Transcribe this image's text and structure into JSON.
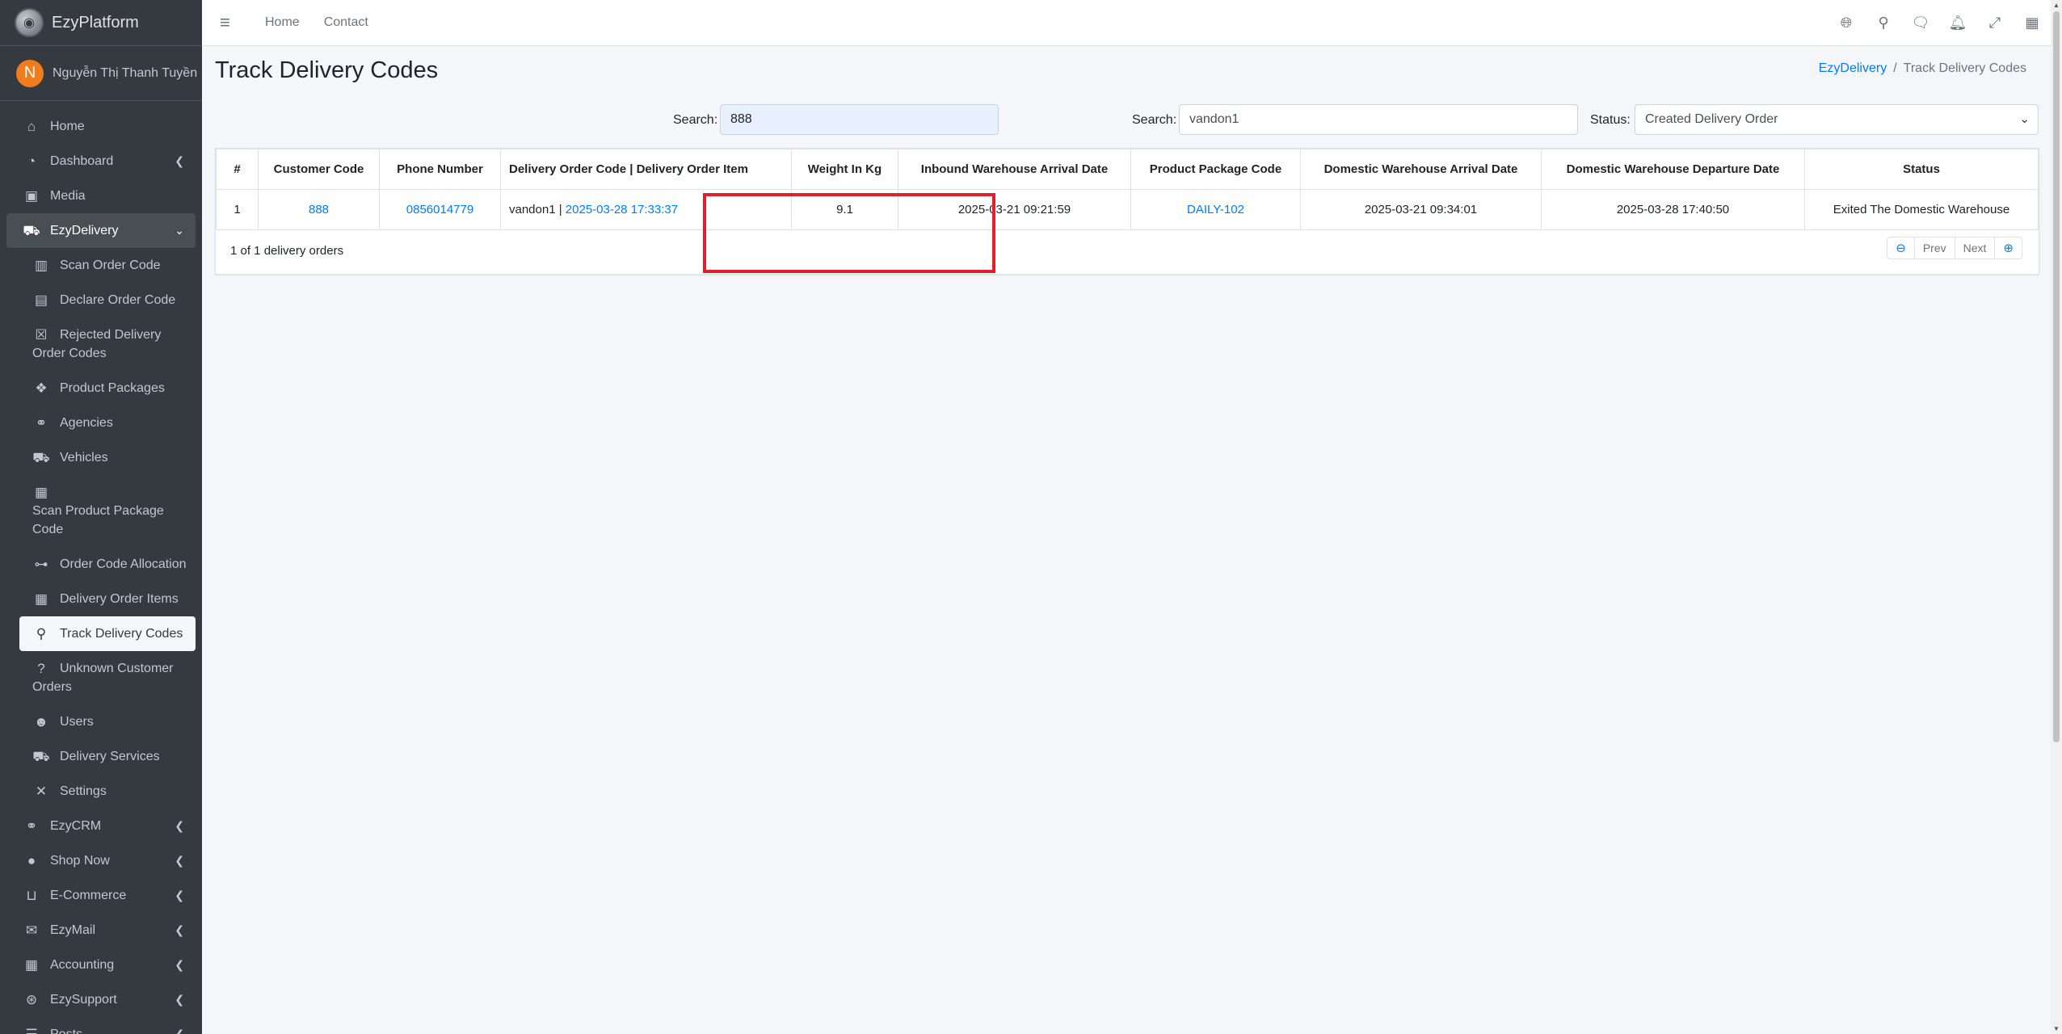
{
  "brand": {
    "name": "EzyPlatform",
    "logo_icon": "ezyplatform-logo-icon"
  },
  "user": {
    "initial": "N",
    "name": "Nguyễn Thị Thanh Tuyền"
  },
  "sidebar": {
    "items": [
      {
        "label": "Home",
        "icon": "home-icon"
      },
      {
        "label": "Dashboard",
        "icon": "dashboard-icon"
      },
      {
        "label": "Media",
        "icon": "image-icon"
      },
      {
        "label": "EzyDelivery",
        "icon": "truck-icon"
      }
    ],
    "sub_items": [
      {
        "label": "Scan Order Code",
        "icon": "barcode-icon"
      },
      {
        "label": "Declare Order Code",
        "icon": "file-icon"
      },
      {
        "label": "Rejected Delivery",
        "label2": "Order Codes",
        "icon": "x-box-icon"
      },
      {
        "label": "Product Packages",
        "icon": "boxes-icon"
      },
      {
        "label": "Agencies",
        "icon": "handshake-icon"
      },
      {
        "label": "Vehicles",
        "icon": "truck-icon"
      },
      {
        "label": "Scan Product Package",
        "label2": "Code",
        "icon": "grid-icon"
      },
      {
        "label": "Order Code Allocation",
        "icon": "sitemap-icon"
      },
      {
        "label": "Delivery Order Items",
        "icon": "table-icon"
      },
      {
        "label": "Track Delivery Codes",
        "icon": "search-icon"
      },
      {
        "label": "Unknown Customer",
        "label2": "Orders",
        "icon": "question-icon"
      },
      {
        "label": "Users",
        "icon": "users-icon"
      },
      {
        "label": "Delivery Services",
        "icon": "truck-icon"
      },
      {
        "label": "Settings",
        "icon": "tools-icon"
      }
    ],
    "bottom_items": [
      {
        "label": "EzyCRM",
        "icon": "handshake-icon"
      },
      {
        "label": "Shop Now",
        "icon": "circle-icon"
      },
      {
        "label": "E-Commerce",
        "icon": "basket-icon"
      },
      {
        "label": "EzyMail",
        "icon": "envelope-icon"
      },
      {
        "label": "Accounting",
        "icon": "calculator-icon"
      },
      {
        "label": "EzySupport",
        "icon": "lifering-icon"
      },
      {
        "label": "Posts",
        "icon": "list-icon"
      }
    ]
  },
  "topbar": {
    "links": [
      "Home",
      "Contact"
    ],
    "icons": [
      "globe-icon",
      "search-icon",
      "comments-icon",
      "bell-icon",
      "expand-icon",
      "apps-icon"
    ]
  },
  "page": {
    "title": "Track Delivery Codes",
    "breadcrumb": [
      "EzyDelivery",
      "Track Delivery Codes"
    ]
  },
  "filters": {
    "search1_label": "Search:",
    "search1_value": "888",
    "search2_label": "Search:",
    "search2_value": "vandon1",
    "status_label": "Status:",
    "status_value": "Created Delivery Order"
  },
  "table": {
    "headers": [
      "#",
      "Customer Code",
      "Phone Number",
      "Delivery Order Code | Delivery Order Item",
      "Weight In Kg",
      "Inbound Warehouse Arrival Date",
      "Product Package Code",
      "Domestic Warehouse Arrival Date",
      "Domestic Warehouse Departure Date",
      "Status"
    ],
    "rows": [
      {
        "index": "1",
        "customer_code": "888",
        "phone": "0856014779",
        "order_code": "vandon1",
        "order_sep": " | ",
        "order_item": "2025-03-28 17:33:37",
        "weight": "9.1",
        "inbound_date": "2025-03-21 09:21:59",
        "package_code": "DAILY-102",
        "domestic_arrival": "2025-03-21 09:34:01",
        "domestic_departure": "2025-03-28 17:40:50",
        "status": "Exited The Domestic Warehouse"
      }
    ],
    "summary": "1 of 1 delivery orders"
  },
  "pager": {
    "prev": "Prev",
    "next": "Next"
  },
  "colors": {
    "sidebar": "#343a40",
    "link": "#007bff",
    "highlight": "#e0202e",
    "avatar": "#f07c1d"
  }
}
